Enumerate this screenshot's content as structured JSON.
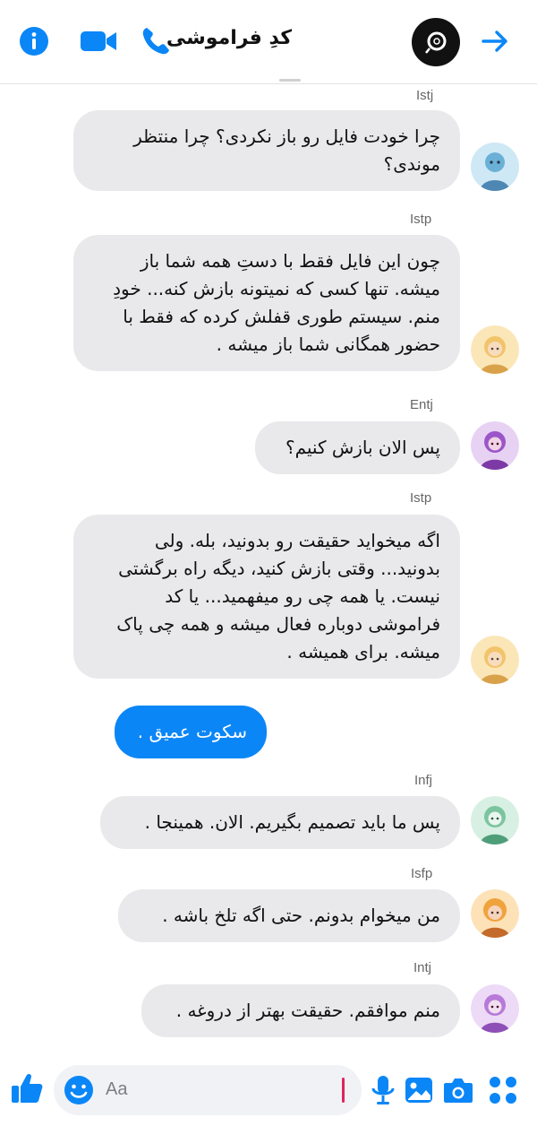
{
  "header": {
    "title": "کدِ فراموشی",
    "icons": [
      "info-icon",
      "video-camera-icon",
      "phone-icon",
      "forward-arrow-icon"
    ],
    "accent": "#0b86f7"
  },
  "messages": [
    {
      "sender": "Istj",
      "text": "چرا خودت فایل رو باز نکردی؟ چرا منتظر موندی؟",
      "avatar_color": "#6bb0d6"
    },
    {
      "sender": "Istp",
      "text": "چون این فایل فقط با دستِ همه شما باز میشه. تنها کسی که نمیتونه بازش کنه... خودِ منم. سیستم طوری قفلش کرده که فقط با حضور همگانی شما باز میشه .",
      "avatar_color": "#f2c46a"
    },
    {
      "sender": "Entj",
      "text": "پس الان بازش کنیم؟",
      "avatar_color": "#9b55c9"
    },
    {
      "sender": "Istp",
      "text": "اگه میخواید حقیقت رو بدونید، بله. ولی بدونید... وقتی بازش کنید، دیگه راه برگشتی نیست. یا همه چی رو میفهمید... یا کد فراموشی دوباره فعال میشه و همه چی پاک میشه. برای همیشه .",
      "avatar_color": "#f2c46a"
    },
    {
      "sender": "",
      "text": "سکوت عمیق .",
      "own": true
    },
    {
      "sender": "Infj",
      "text": "پس ما باید تصمیم بگیریم. الان. همینجا .",
      "avatar_color": "#7cc4a0"
    },
    {
      "sender": "Isfp",
      "text": "من میخوام بدونم. حتی اگه تلخ باشه .",
      "avatar_color": "#f0a23c"
    },
    {
      "sender": "Intj",
      "text": "منم موافقم. حقیقت بهتر از دروغه .",
      "avatar_color": "#b77ad8"
    }
  ],
  "composer": {
    "placeholder": "Aa",
    "icons": [
      "like-icon",
      "emoji-icon",
      "microphone-icon",
      "image-icon",
      "camera-icon",
      "apps-icon"
    ]
  }
}
